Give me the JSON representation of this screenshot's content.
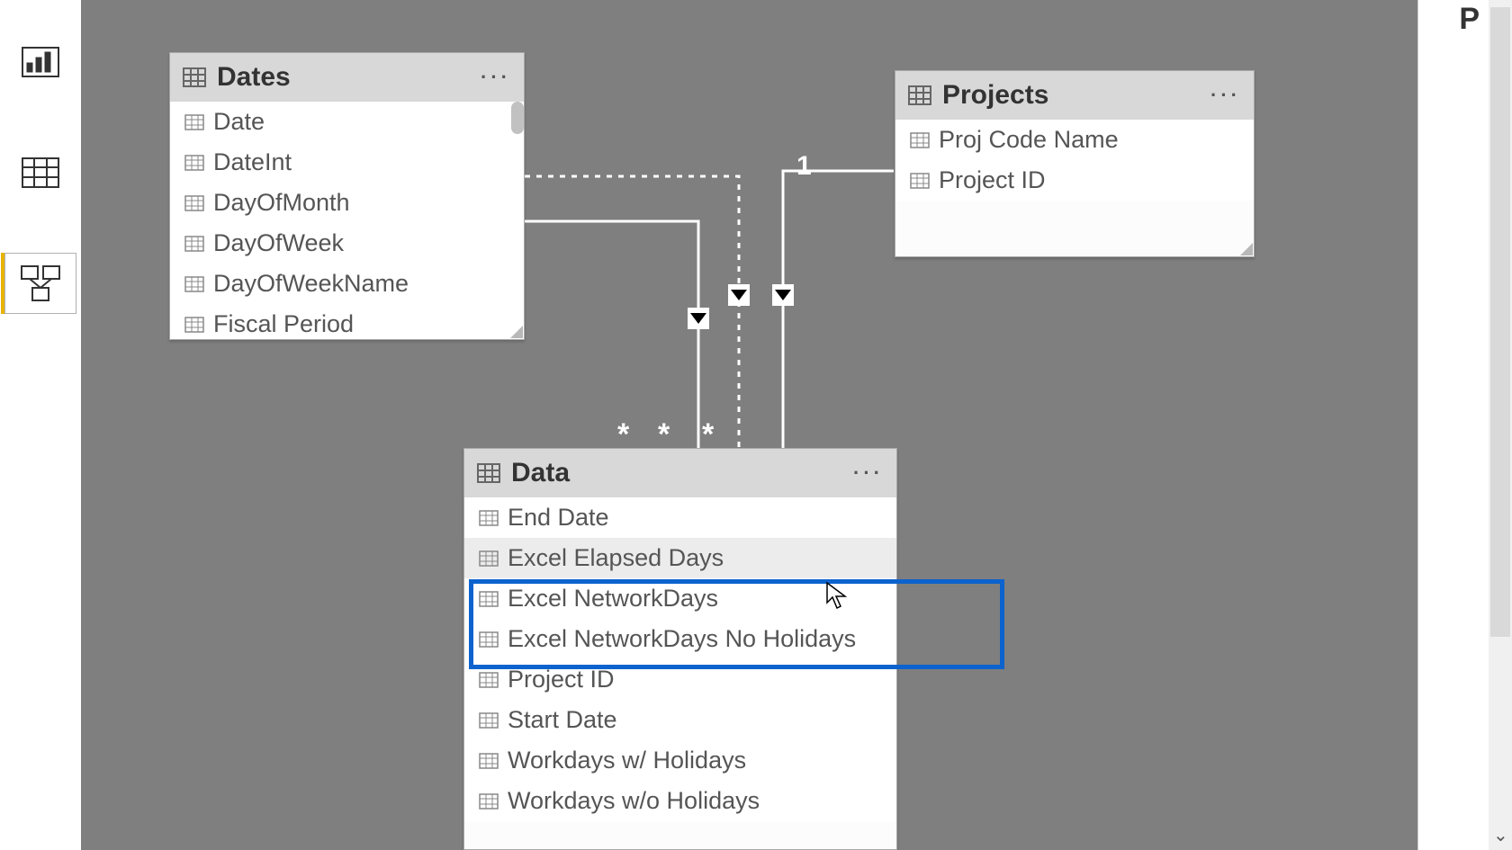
{
  "rail": {
    "report": "Report",
    "data": "Data",
    "model": "Model"
  },
  "tables": {
    "dates": {
      "title": "Dates",
      "fields": [
        "Date",
        "DateInt",
        "DayOfMonth",
        "DayOfWeek",
        "DayOfWeekName",
        "Fiscal Period"
      ]
    },
    "projects": {
      "title": "Projects",
      "fields": [
        "Proj Code Name",
        "Project ID"
      ]
    },
    "data": {
      "title": "Data",
      "fields": [
        "End Date",
        "Excel Elapsed Days",
        "Excel NetworkDays",
        "Excel NetworkDays No Holidays",
        "Project ID",
        "Start Date",
        "Workdays w/ Holidays",
        "Workdays w/o Holidays"
      ]
    }
  },
  "relationships": {
    "one_label": "1",
    "many_label": "*"
  },
  "panel_hint": "P"
}
